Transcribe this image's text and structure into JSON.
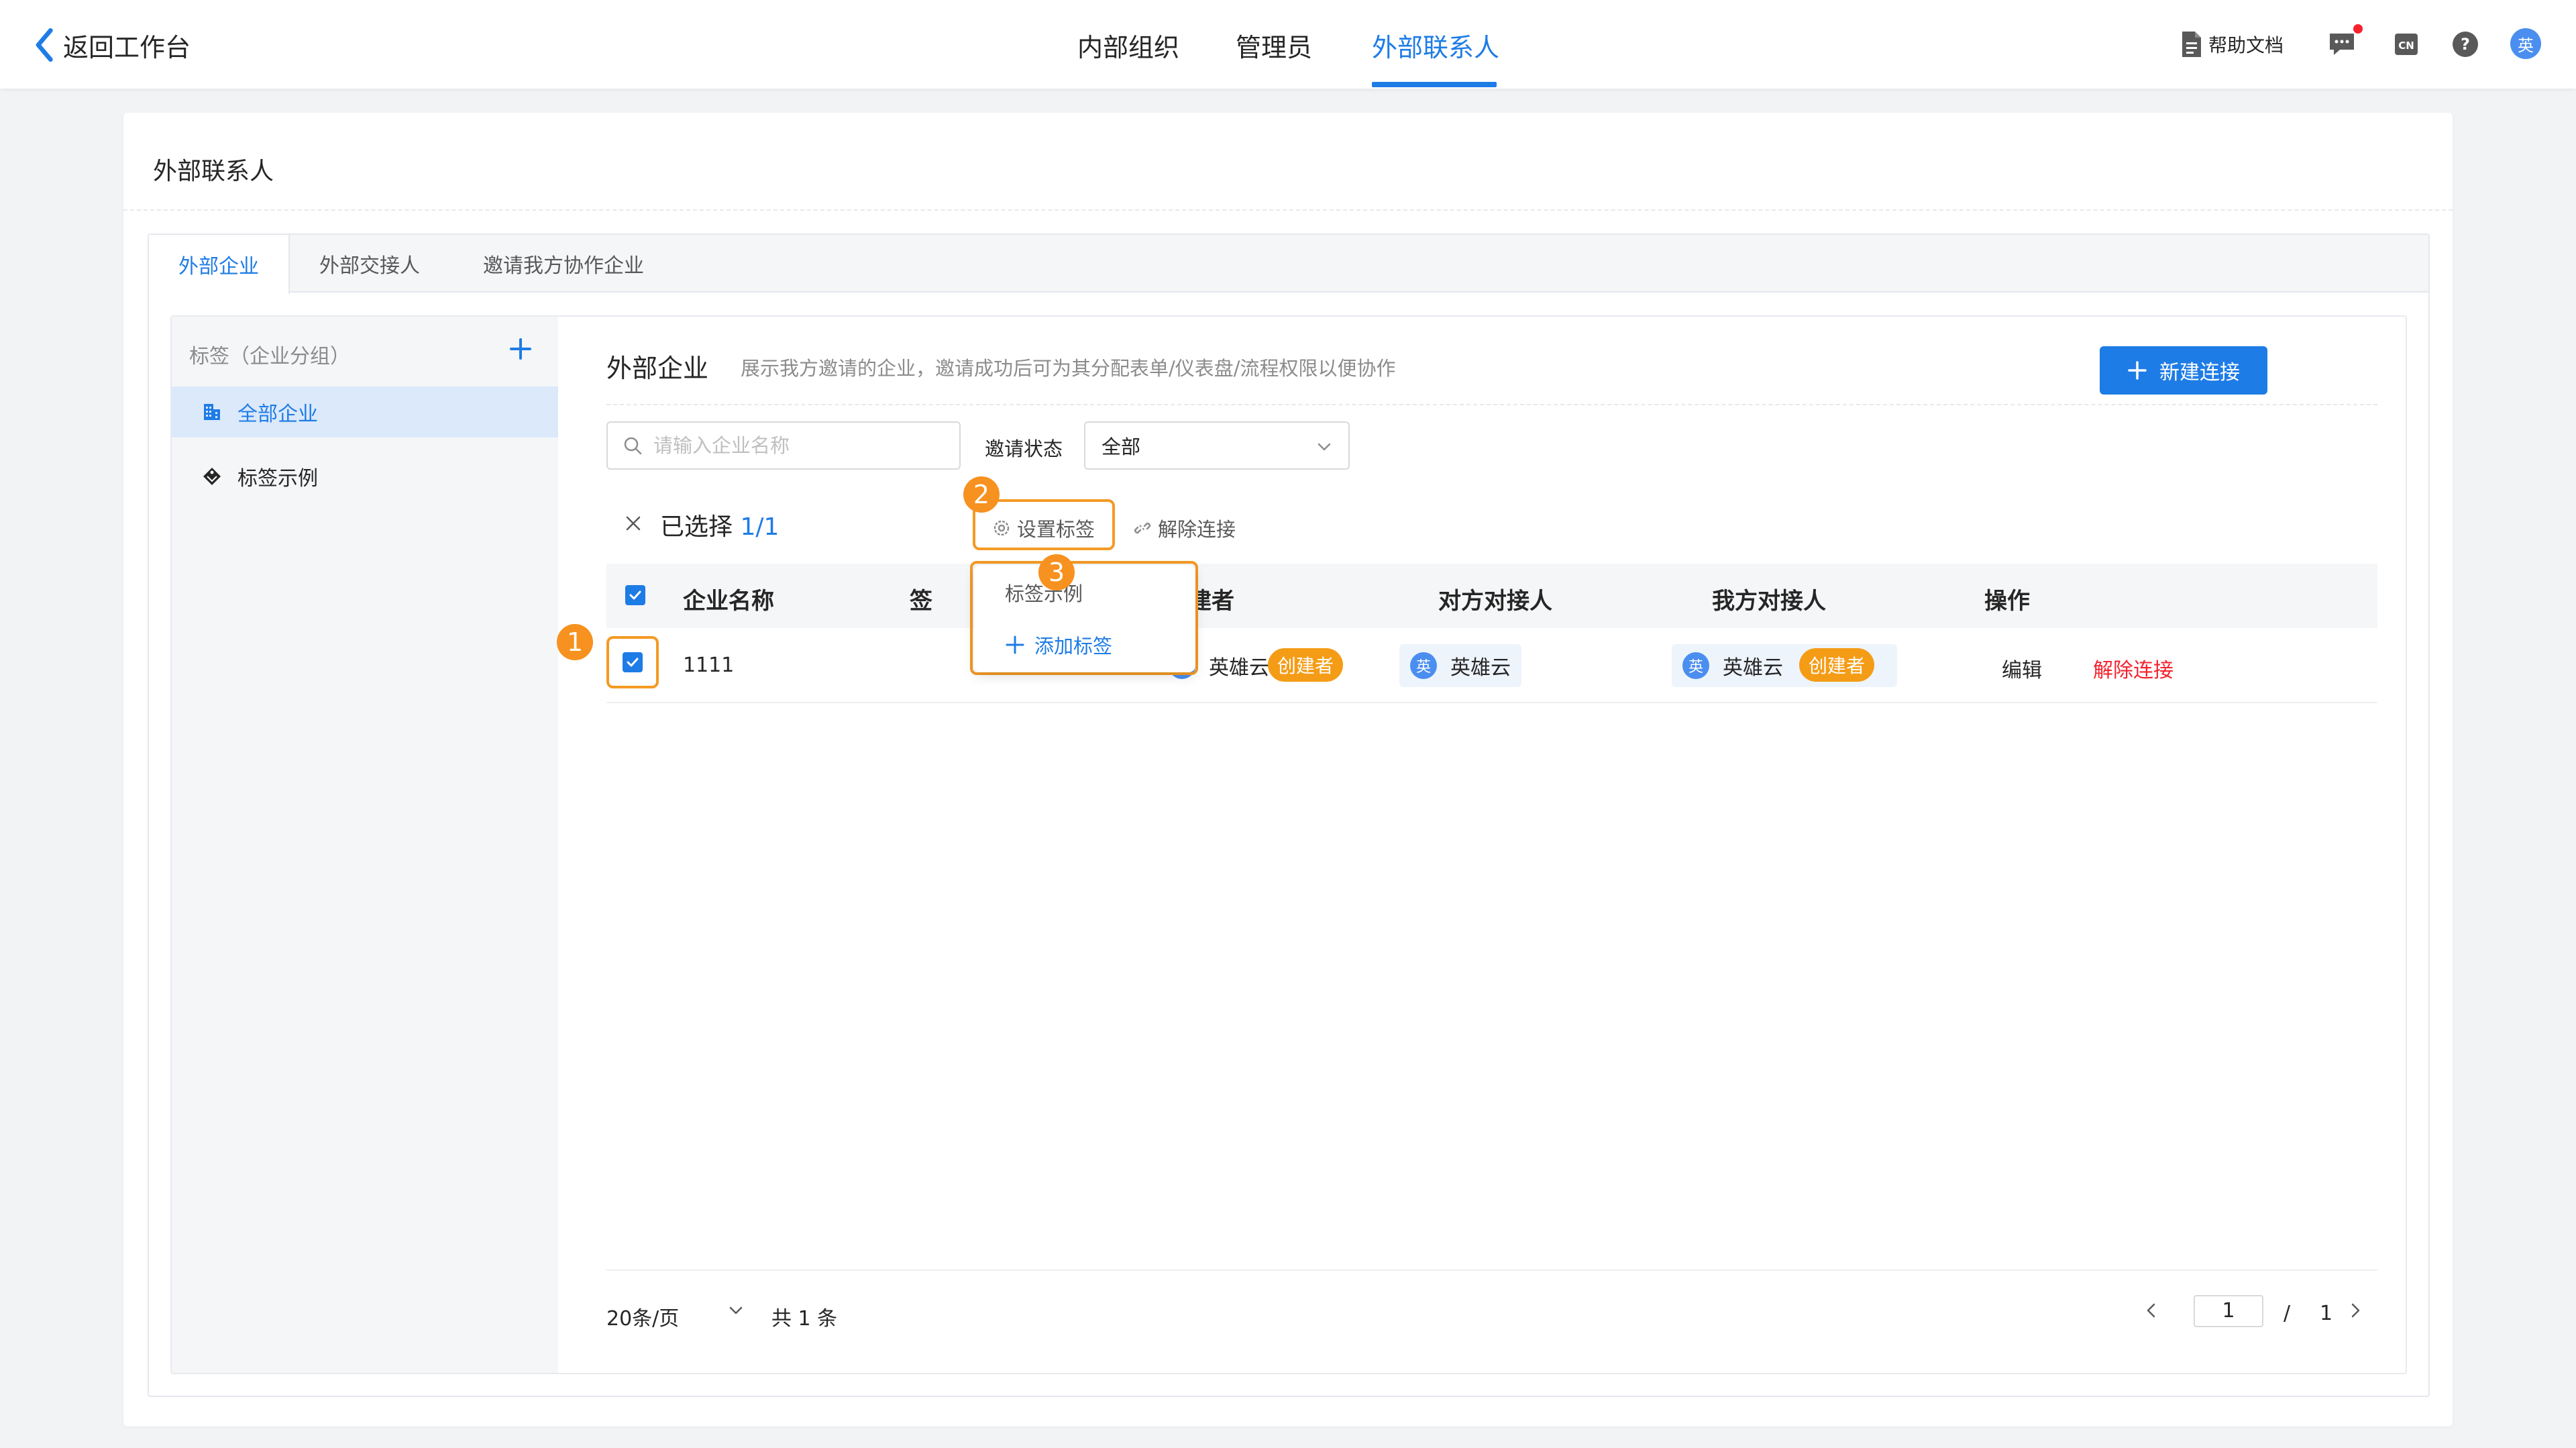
{
  "topbar": {
    "back_label": "返回工作台",
    "nav": [
      "内部组织",
      "管理员",
      "外部联系人"
    ],
    "help_label": "帮助文档",
    "lang_label": "CN",
    "avatar_text": "英"
  },
  "page": {
    "title": "外部联系人"
  },
  "tabs": [
    "外部企业",
    "外部交接人",
    "邀请我方协作企业"
  ],
  "sidebar": {
    "heading": "标签（企业分组）",
    "items": [
      {
        "label": "全部企业",
        "icon": "building-icon"
      },
      {
        "label": "标签示例",
        "icon": "tag-icon"
      }
    ]
  },
  "section": {
    "title": "外部企业",
    "description": "展示我方邀请的企业，邀请成功后可为其分配表单/仪表盘/流程权限以便协作",
    "new_button": "新建连接"
  },
  "filters": {
    "search_placeholder": "请输入企业名称",
    "status_label": "邀请状态",
    "status_value": "全部"
  },
  "selection": {
    "label": "已选择",
    "count": "1/1",
    "set_tag": "设置标签",
    "disconnect": "解除连接"
  },
  "dropdown": {
    "items": [
      "标签示例",
      "添加标签"
    ]
  },
  "table": {
    "columns": [
      "企业名称",
      "签",
      "创建者",
      "对方对接人",
      "我方对接人",
      "操作"
    ],
    "rows": [
      {
        "name": "1111",
        "creator": "英雄云",
        "creator_badge": "创建者",
        "their_contact": "英雄云",
        "our_contact": "英雄云",
        "our_badge": "创建者",
        "actions": [
          "编辑",
          "解除连接"
        ],
        "avatar_text": "英"
      }
    ]
  },
  "pagination": {
    "page_size": "20条/页",
    "total": "共 1 条",
    "current": "1",
    "separator": "/",
    "pages": "1"
  },
  "markers": [
    "1",
    "2",
    "3"
  ],
  "colors": {
    "accent": "#1e7ce6",
    "highlight": "#f49a24",
    "danger": "#f5222d"
  }
}
